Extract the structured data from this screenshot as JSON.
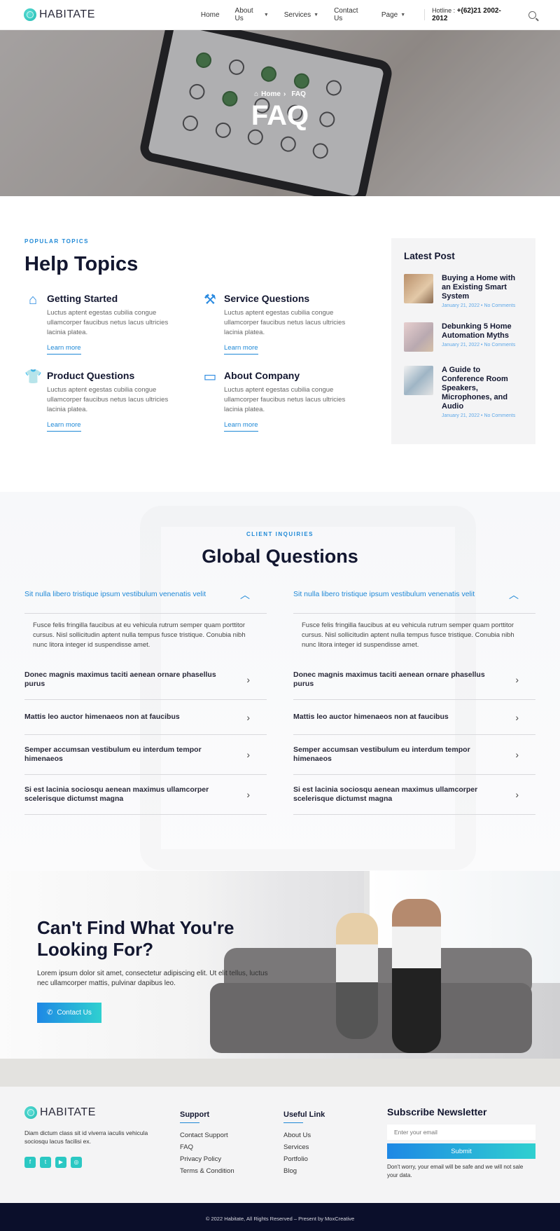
{
  "header": {
    "brand": "HABITATE",
    "nav": [
      {
        "label": "Home",
        "dropdown": false
      },
      {
        "label": "About Us",
        "dropdown": true
      },
      {
        "label": "Services",
        "dropdown": true
      },
      {
        "label": "Contact Us",
        "dropdown": false
      },
      {
        "label": "Page",
        "dropdown": true
      }
    ],
    "hotline_label": "Hotline :",
    "hotline_number": "+(62)21 2002-2012"
  },
  "hero": {
    "breadcrumb_home": "Home",
    "breadcrumb_current": "FAQ",
    "title": "FAQ"
  },
  "help": {
    "eyebrow": "POPULAR TOPICS",
    "title": "Help Topics",
    "topics": [
      {
        "title": "Getting Started",
        "text": "Luctus aptent egestas cubilia congue ullamcorper faucibus netus lacus ultricies lacinia platea.",
        "link": "Learn more",
        "icon": "home-icon"
      },
      {
        "title": "Service Questions",
        "text": "Luctus aptent egestas cubilia congue ullamcorper faucibus netus lacus ultricies lacinia platea.",
        "link": "Learn more",
        "icon": "tools-icon"
      },
      {
        "title": "Product Questions",
        "text": "Luctus aptent egestas cubilia congue ullamcorper faucibus netus lacus ultricies lacinia platea.",
        "link": "Learn more",
        "icon": "shirt-icon"
      },
      {
        "title": "About Company",
        "text": "Luctus aptent egestas cubilia congue ullamcorper faucibus netus lacus ultricies lacinia platea.",
        "link": "Learn more",
        "icon": "id-card-icon"
      }
    ]
  },
  "latest": {
    "title": "Latest Post",
    "posts": [
      {
        "title": "Buying a Home with an Existing Smart System",
        "date": "January 21, 2022",
        "comments": "No Comments"
      },
      {
        "title": "Debunking 5 Home Automation Myths",
        "date": "January 21, 2022",
        "comments": "No Comments"
      },
      {
        "title": "A Guide to Conference Room Speakers, Microphones, and Audio",
        "date": "January 21, 2022",
        "comments": "No Comments"
      }
    ]
  },
  "faq": {
    "eyebrow": "CLIENT INQUIRIES",
    "title": "Global Questions",
    "columns": [
      {
        "open_question": "Sit nulla libero tristique ipsum vestibulum venenatis velit",
        "open_answer": "Fusce felis fringilla faucibus at eu vehicula rutrum semper quam porttitor cursus. Nisl sollicitudin aptent nulla tempus fusce tristique. Conubia nibh nunc litora integer id suspendisse amet.",
        "questions": [
          "Donec magnis maximus taciti aenean ornare phasellus purus",
          "Mattis leo auctor himenaeos non at faucibus",
          "Semper accumsan vestibulum eu interdum tempor himenaeos",
          "Si est lacinia sociosqu aenean maximus ullamcorper scelerisque dictumst magna"
        ]
      },
      {
        "open_question": "Sit nulla libero tristique ipsum vestibulum venenatis velit",
        "open_answer": "Fusce felis fringilla faucibus at eu vehicula rutrum semper quam porttitor cursus. Nisl sollicitudin aptent nulla tempus fusce tristique. Conubia nibh nunc litora integer id suspendisse amet.",
        "questions": [
          "Donec magnis maximus taciti aenean ornare phasellus purus",
          "Mattis leo auctor himenaeos non at faucibus",
          "Semper accumsan vestibulum eu interdum tempor himenaeos",
          "Si est lacinia sociosqu aenean maximus ullamcorper scelerisque dictumst magna"
        ]
      }
    ]
  },
  "cta": {
    "title": "Can't Find What You're Looking For?",
    "text": "Lorem ipsum dolor sit amet, consectetur adipiscing elit. Ut elit tellus, luctus nec ullamcorper mattis, pulvinar dapibus leo.",
    "button": "Contact Us"
  },
  "footer": {
    "brand": "HABITATE",
    "about": "Diam dictum class sit id viverra iaculis vehicula sociosqu lacus facilisi ex.",
    "socials": [
      "facebook-icon",
      "twitter-icon",
      "youtube-icon",
      "instagram-icon"
    ],
    "support_title": "Support",
    "support_links": [
      "Contact Support",
      "FAQ",
      "Privacy Policy",
      "Terms & Condition"
    ],
    "useful_title": "Useful Link",
    "useful_links": [
      "About Us",
      "Services",
      "Portfolio",
      "Blog"
    ],
    "newsletter_title": "Subscribe Newsletter",
    "email_placeholder": "Enter your email",
    "submit": "Submit",
    "note": "Don't worry, your email will be safe and we will not sale your data."
  },
  "copyright": "© 2022 Habitate, All Rights Reserved – Present by MoxCreative",
  "colors": {
    "accent": "#1e88d6",
    "teal": "#2bc8c3",
    "dark": "#0b0f2b"
  }
}
